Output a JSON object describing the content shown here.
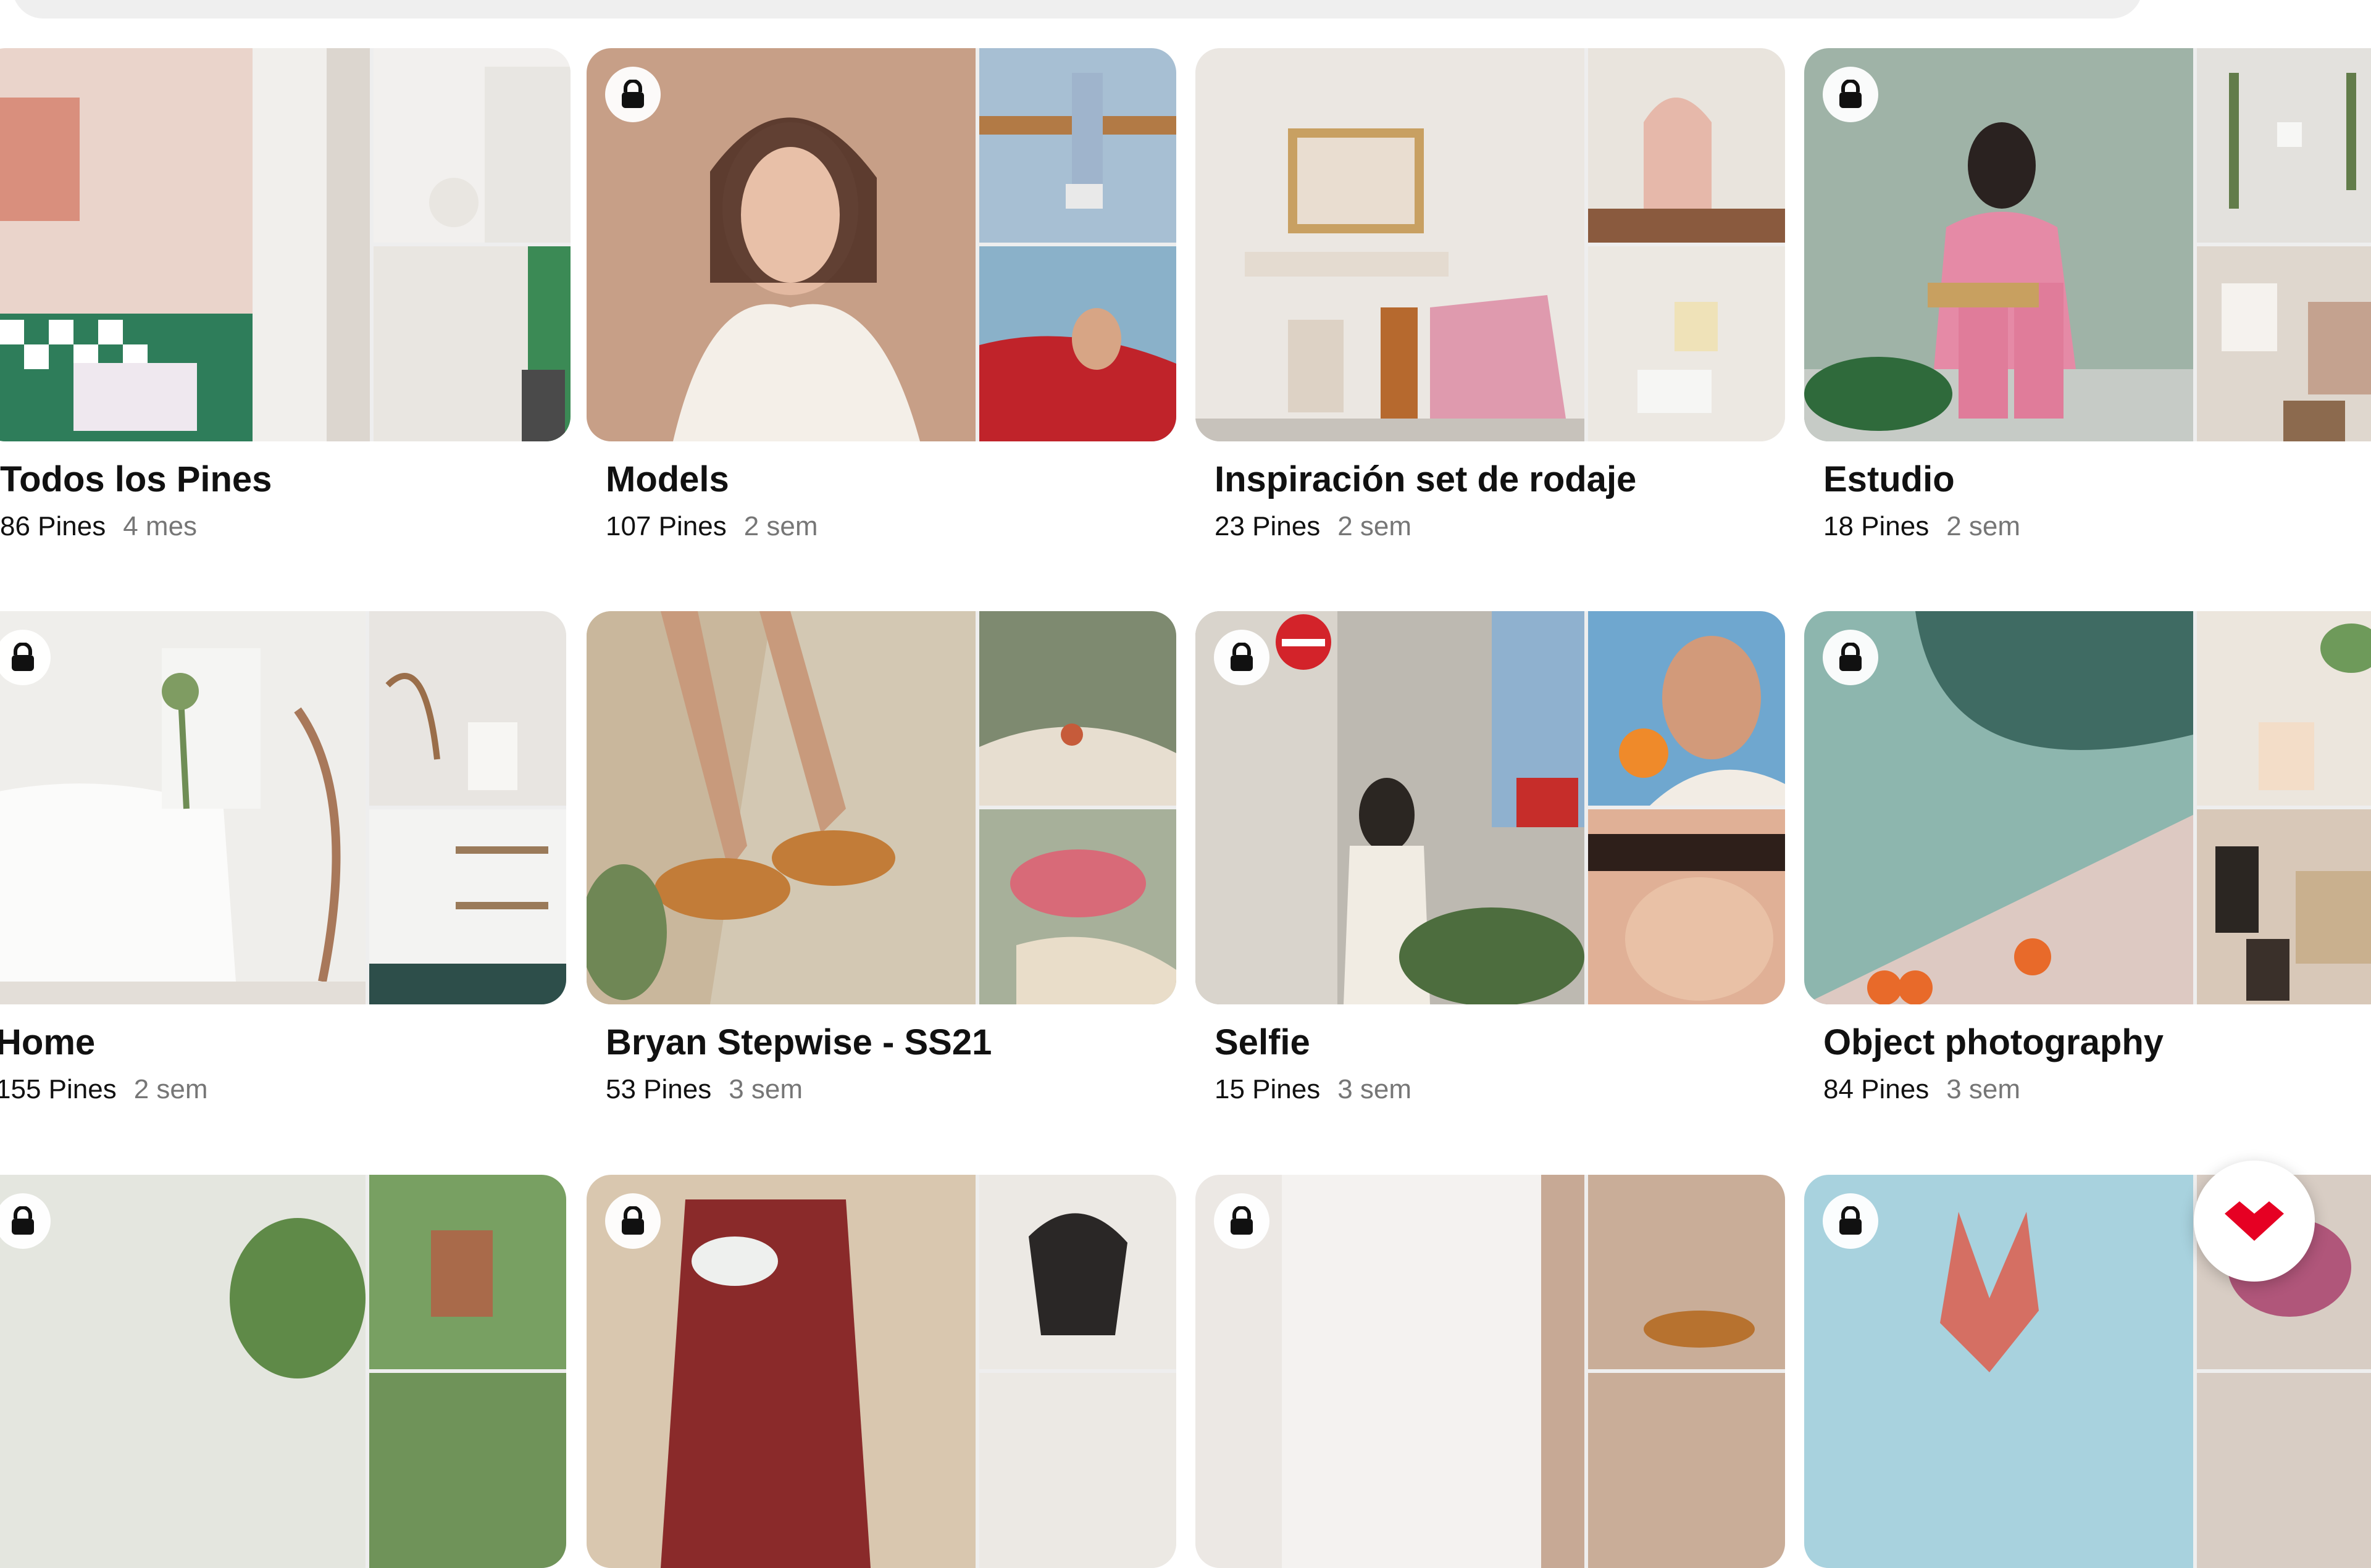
{
  "boards": [
    {
      "id": "todos",
      "name": "Todos los Pines",
      "pins": "86 Pines",
      "age": "4 mes",
      "private": false,
      "colors": {
        "main": "#e9c9bf",
        "tr": "#e4ded6",
        "br": "#c7d1c6"
      }
    },
    {
      "id": "models",
      "name": "Models",
      "pins": "107 Pines",
      "age": "2 sem",
      "private": true,
      "colors": {
        "main": "#c9a58f",
        "tr": "#9bb2c6",
        "br": "#b8322e"
      }
    },
    {
      "id": "inspiracion",
      "name": "Inspiración set de rodaje",
      "pins": "23 Pines",
      "age": "2 sem",
      "private": false,
      "colors": {
        "main": "#e7e2dc",
        "tr": "#d7b8ac",
        "br": "#ece8e2"
      }
    },
    {
      "id": "estudio",
      "name": "Estudio",
      "pins": "18 Pines",
      "age": "2 sem",
      "private": true,
      "colors": {
        "main": "#a9b6ad",
        "tr": "#e2e0dc",
        "br": "#d8cfc6"
      }
    },
    {
      "id": "home",
      "name": "Home",
      "pins": "155 Pines",
      "age": "2 sem",
      "private": true,
      "colors": {
        "main": "#ecebe7",
        "tr": "#e4e1dc",
        "br": "#dcdcd8"
      }
    },
    {
      "id": "bryan",
      "name": "Bryan Stepwise - SS21",
      "pins": "53 Pines",
      "age": "3 sem",
      "private": false,
      "colors": {
        "main": "#cfc3ad",
        "tr": "#8f9a86",
        "br": "#b7b5a6"
      }
    },
    {
      "id": "selfie",
      "name": "Selfie",
      "pins": "15 Pines",
      "age": "3 sem",
      "private": true,
      "colors": {
        "main": "#b9b4ab",
        "tr": "#d9a98c",
        "br": "#cf8b6c"
      }
    },
    {
      "id": "object",
      "name": "Object photography",
      "pins": "84 Pines",
      "age": "3 sem",
      "private": true,
      "colors": {
        "main": "#8fb4ac",
        "tr": "#ece6de",
        "br": "#b99585"
      }
    },
    {
      "id": "row3a",
      "name": "",
      "pins": "",
      "age": "",
      "private": true,
      "colors": {
        "main": "#e3e6df",
        "tr": "#7c9a6a",
        "br": "#7c9a6a"
      }
    },
    {
      "id": "row3b",
      "name": "",
      "pins": "",
      "age": "",
      "private": true,
      "colors": {
        "main": "#d8c4ad",
        "tr": "#ece8e2",
        "br": "#ece8e2"
      }
    },
    {
      "id": "row3c",
      "name": "",
      "pins": "",
      "age": "",
      "private": true,
      "colors": {
        "main": "#ebe6e2",
        "tr": "#c2a493",
        "br": "#c2a493"
      }
    },
    {
      "id": "row3d",
      "name": "",
      "pins": "",
      "age": "",
      "private": true,
      "colors": {
        "main": "#a9d3df",
        "tr": "#d7ccc4",
        "br": "#d7ccc4"
      }
    }
  ],
  "accent": "#e60023",
  "fab": {
    "icon": "brand-logo-icon"
  }
}
